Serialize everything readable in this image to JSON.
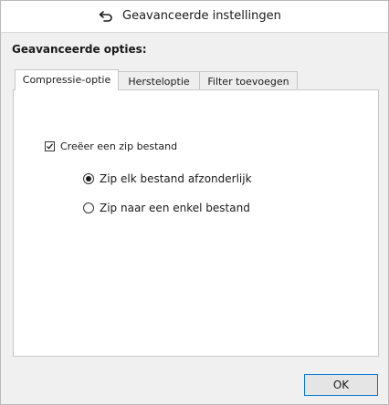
{
  "window": {
    "title": "Geavanceerde instellingen",
    "back_icon": "back-arrow-icon"
  },
  "section": {
    "heading": "Geavanceerde opties:"
  },
  "tabs": [
    {
      "label": "Compressie-optie",
      "active": true
    },
    {
      "label": "Hersteloptie",
      "active": false
    },
    {
      "label": "Filter toevoegen",
      "active": false
    }
  ],
  "compression": {
    "create_zip": {
      "label": "Creëer een zip bestand",
      "checked": true
    },
    "zip_mode_options": [
      {
        "label": "Zip elk bestand afzonderlijk",
        "selected": true
      },
      {
        "label": "Zip naar een enkel bestand",
        "selected": false
      }
    ]
  },
  "footer": {
    "ok_label": "OK"
  },
  "colors": {
    "focus_border": "#0078d7",
    "panel_background": "#ffffff",
    "dialog_background": "#f0f0f0"
  }
}
